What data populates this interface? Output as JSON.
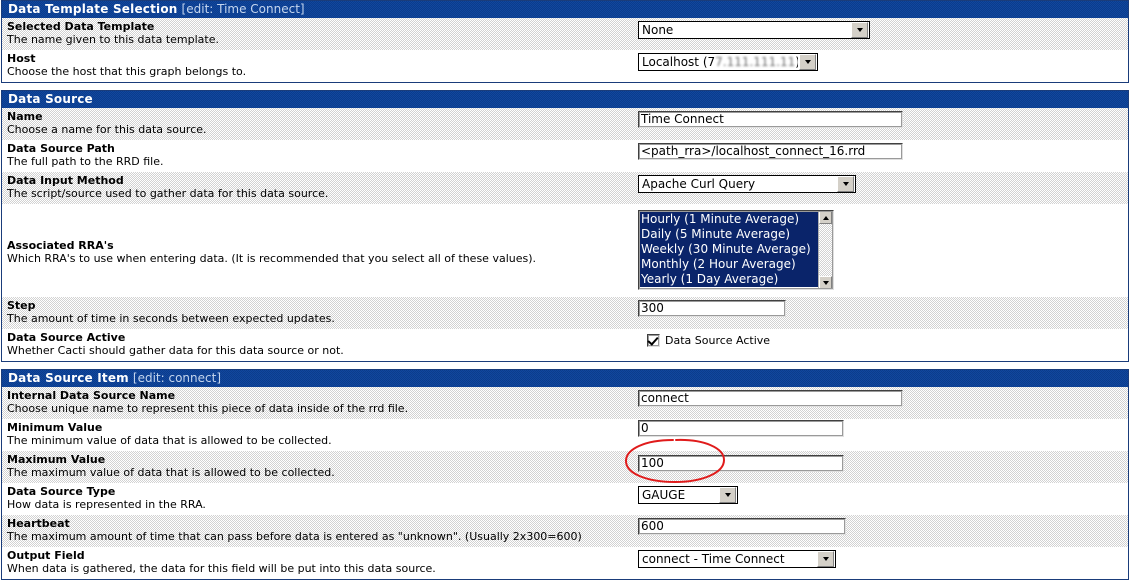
{
  "sections": [
    {
      "id": "data-template-selection",
      "title": "Data Template Selection",
      "edit": "[edit: Time Connect]",
      "rows": [
        {
          "name": "Selected Data Template",
          "desc": "The name given to this data template.",
          "control": "select",
          "value": "None"
        },
        {
          "name": "Host",
          "desc": "Choose the host that this graph belongs to.",
          "control": "select",
          "value": "Localhost (7",
          "value_redacted": "7.111.111.11",
          "value_suffix": ")"
        }
      ]
    },
    {
      "id": "data-source",
      "title": "Data Source",
      "edit": "",
      "rows": [
        {
          "name": "Name",
          "desc": "Choose a name for this data source.",
          "control": "text",
          "value": "Time Connect"
        },
        {
          "name": "Data Source Path",
          "desc": "The full path to the RRD file.",
          "control": "text",
          "value": "<path_rra>/localhost_connect_16.rrd"
        },
        {
          "name": "Data Input Method",
          "desc": "The script/source used to gather data for this data source.",
          "control": "select",
          "value": "Apache Curl Query"
        },
        {
          "name": "Associated RRA's",
          "desc": "Which RRA's to use when entering data. (It is recommended that you select all of these values).",
          "control": "listbox",
          "options": [
            {
              "label": "Hourly (1 Minute Average)",
              "selected": true
            },
            {
              "label": "Daily (5 Minute Average)",
              "selected": true
            },
            {
              "label": "Weekly (30 Minute Average)",
              "selected": true
            },
            {
              "label": "Monthly (2 Hour Average)",
              "selected": true
            },
            {
              "label": "Yearly (1 Day Average)",
              "selected": true
            }
          ]
        },
        {
          "name": "Step",
          "desc": "The amount of time in seconds between expected updates.",
          "control": "text",
          "value": "300"
        },
        {
          "name": "Data Source Active",
          "desc": "Whether Cacti should gather data for this data source or not.",
          "control": "checkbox",
          "checkbox_label": "Data Source Active",
          "checked": true
        }
      ]
    },
    {
      "id": "data-source-item",
      "title": "Data Source Item",
      "edit": "[edit: connect]",
      "rows": [
        {
          "name": "Internal Data Source Name",
          "desc": "Choose unique name to represent this piece of data inside of the rrd file.",
          "control": "text",
          "value": "connect"
        },
        {
          "name": "Minimum Value",
          "desc": "The minimum value of data that is allowed to be collected.",
          "control": "text",
          "value": "0"
        },
        {
          "name": "Maximum Value",
          "desc": "The maximum value of data that is allowed to be collected.",
          "control": "text",
          "value": "100",
          "annotated": true
        },
        {
          "name": "Data Source Type",
          "desc": "How data is represented in the RRA.",
          "control": "select",
          "value": "GAUGE"
        },
        {
          "name": "Heartbeat",
          "desc": "The maximum amount of time that can pass before data is entered as \"unknown\". (Usually 2x300=600)",
          "control": "text",
          "value": "600"
        },
        {
          "name": "Output Field",
          "desc": "When data is gathered, the data for this field will be put into this data source.",
          "control": "select",
          "value": "connect - Time Connect"
        }
      ]
    }
  ],
  "annotation": {
    "type": "ellipse",
    "color": "#e01b1b",
    "target": "Maximum Value input"
  },
  "colors": {
    "header_blue": "#0b3c8c",
    "header_blue_light": "#11479e",
    "border": "#1a3c7a",
    "row_dither": "#d2d2d2",
    "row_white": "#ffffff",
    "select_highlight": "#0a246a",
    "annotation_red": "#e01b1b"
  }
}
